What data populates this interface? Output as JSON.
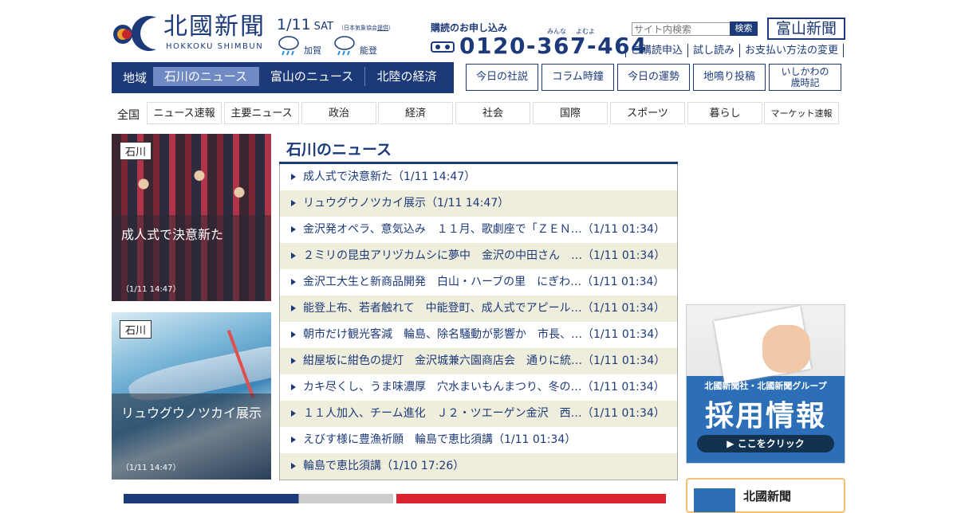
{
  "header": {
    "logo_title": "北國新聞",
    "logo_sub": "HOKKOKU SHIMBUN",
    "date": "1/11",
    "weekday": "SAT",
    "date_credit_prefix": "（日本気象協会",
    "date_credit_link": "提供",
    "date_credit_suffix": "）",
    "weather": [
      {
        "label": "加賀",
        "icon": "rain-icon"
      },
      {
        "label": "能登",
        "icon": "rain-icon"
      }
    ],
    "subscribe_label": "購読のお申し込み",
    "tel_ruby_1": "みんな",
    "tel_ruby_2": "よむよ",
    "tel": "0120-367-464",
    "search_placeholder": "サイト内検索",
    "search_button": "検索",
    "toyama_button": "富山新聞",
    "sub_links": [
      "ご購読申込",
      "試し読み",
      "お支払い方法の変更"
    ]
  },
  "region": {
    "label": "地域",
    "tabs": [
      "石川のニュース",
      "富山のニュース",
      "北陸の経済"
    ],
    "active_tab": 0
  },
  "column_buttons": [
    "今日の社説",
    "コラム時鐘",
    "今日の運勢",
    "地鳴り投稿",
    "いしかわの\n歳時記"
  ],
  "categories": {
    "all_label": "全国",
    "items": [
      "ニュース速報",
      "主要ニュース",
      "政治",
      "経済",
      "社会",
      "国際",
      "スポーツ",
      "暮らし",
      "マーケット速報"
    ]
  },
  "photos": [
    {
      "tag": "石川",
      "title": "成人式で決意新た",
      "time": "（1/11 14:47）"
    },
    {
      "tag": "石川",
      "title": "リュウグウノツカイ展示",
      "time": "（1/11 14:47）"
    }
  ],
  "news": {
    "heading": "石川のニュース",
    "items": [
      "成人式で決意新た（1/11 14:47）",
      "リュウグウノツカイ展示（1/11 14:47）",
      "金沢発オペラ、意気込み　１１月、歌劇座で「ＺＥＮ…（1/11 01:34）",
      "２ミリの昆虫アリヅカムシに夢中　金沢の中田さん　…（1/11 01:34）",
      "金沢工大生と新商品開発　白山・ハーブの里　にぎわ…（1/11 01:34）",
      "能登上布、若者触れて　中能登町、成人式でアピール…（1/11 01:34）",
      "朝市だけ観光客減　輪島、除名騒動が影響か　市長、…（1/11 01:34）",
      "紺屋坂に紺色の提灯　金沢城兼六園商店会　通りに統…（1/11 01:34）",
      "カキ尽くし、うま味濃厚　穴水まいもんまつり、冬の…（1/11 01:34）",
      "１１人加入、チーム進化　Ｊ２・ツエーゲン金沢　西…（1/11 01:34）",
      "えびす様に豊漁祈願　輪島で恵比須講（1/11 01:34）",
      "輪島で恵比須講（1/10 17:26）"
    ]
  },
  "ad": {
    "sub": "北國新聞社・北國新聞グループ",
    "main": "採用情報",
    "button": "▶ ここをクリック"
  },
  "side_box": {
    "label": "北國新聞"
  },
  "colors": {
    "brand": "#1c3a7a",
    "active_tab": "#6f8ac4",
    "alt_row": "#efeedd"
  }
}
